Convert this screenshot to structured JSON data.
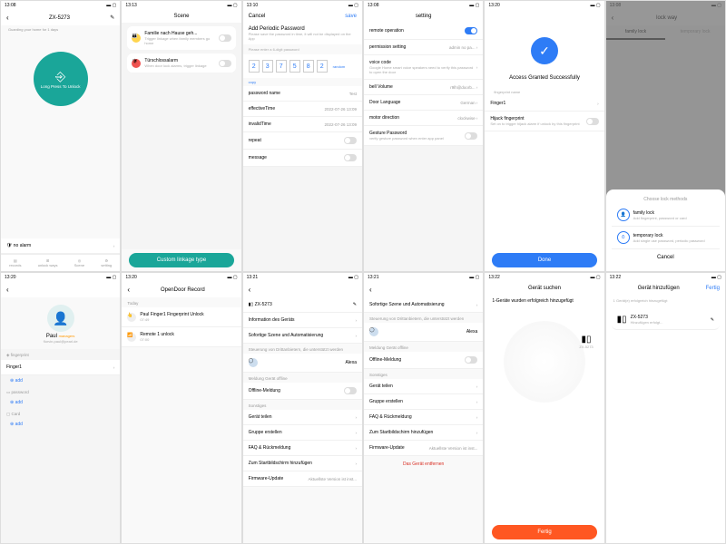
{
  "s1": {
    "time": "13:08",
    "title": "ZX-5273",
    "guard": "Guarding your home for 1 days",
    "btn": "Long Press To Unlock",
    "alarm": "no alarm",
    "tabs": [
      "records",
      "unlock ways",
      "Scene",
      "setting"
    ]
  },
  "s2": {
    "time": "13:13",
    "title": "Scene",
    "c1": "Familie nach Hause geh...",
    "c1s": "Trigger linkage when family members go home",
    "c2": "Türschlossalarm",
    "c2s": "When door lock alarms, trigger linkage",
    "btn": "Custom linkage type"
  },
  "s3": {
    "time": "13:10",
    "cancel": "Cancel",
    "save": "save",
    "title": "Add Periodic Password",
    "hint": "Please save the password in time, it will not be displayed on the App",
    "prompt": "Please enter a 6-digit password",
    "pwd": [
      "2",
      "3",
      "7",
      "5",
      "8",
      "2"
    ],
    "random": "random",
    "copy": "copy",
    "r1": "password name",
    "r1v": "Test",
    "r2": "effectiveTime",
    "r2v": "2022-07-26 13:09",
    "r3": "invalidTime",
    "r3v": "2022-07-26 13:09",
    "r4": "repeat",
    "r5": "message"
  },
  "s4": {
    "time": "13:08",
    "title": "setting",
    "r1": "remote operation",
    "r2": "permission setting",
    "r2v": "admin no pa...",
    "r3": "voice code",
    "r3s": "Google Home smart voice speakers need to verify this password to open the door",
    "r4": "bell Volume",
    "r4v": "r9lh@doorb...",
    "r5": "Door Language",
    "r5v": "German",
    "r6": "motor direction",
    "r6v": "clockwise",
    "r7": "Gesture Password",
    "r7s": "verify gesture password when enter app panel"
  },
  "s5": {
    "time": "13:20",
    "msg": "Access Granted Successfully",
    "fp": "fingerprint name",
    "fn": "Finger1",
    "hj": "Hijack fingerprint",
    "hjs": "Set on to trigger hijack alarm if unlock by this fingerprint",
    "btn": "Done"
  },
  "s6": {
    "time": "13:08",
    "title": "lock way",
    "t1": "family lock",
    "t2": "temporary lock",
    "mtitle": "Choose lock methods",
    "m1": "family lock",
    "m1s": "Add fingerprint, password or card",
    "m2": "temporary lock",
    "m2s": "Add single use password, periodic password",
    "cancel": "Cancel"
  },
  "s7": {
    "time": "13:20",
    "name": "Paul",
    "tag": "managers",
    "email": "florvin.paul@pearl.de",
    "h1": "fingerprint",
    "f1": "Finger1",
    "h2": "password",
    "h3": "Card",
    "add": "add"
  },
  "s8": {
    "time": "13:20",
    "title": "OpenDoor Record",
    "day": "Today",
    "r1": "Paul Finger1 Fingerprint Unlock",
    "r1t": "07:49",
    "r2": "Remote 1 unlock",
    "r2t": "07:00"
  },
  "s9": {
    "time": "13:21",
    "dev": "ZX-5273",
    "h1": "Information des Geräts",
    "h2": "Sofortige Szene und Automatisierung",
    "h3": "Steuerung von Drittanbietern, die unterstützt werden",
    "alexa": "Alexa",
    "h4": "Meldung Gerät offline",
    "off": "Offline-Meldung",
    "h5": "Sonstiges",
    "g1": "Gerät teilen",
    "g2": "Gruppe erstellen",
    "g3": "FAQ & Rückmeldung",
    "g4": "Zum Startbildschirm hinzufügen",
    "g5": "Firmware-Update",
    "g5v": "Aktuellste Version ist inst..."
  },
  "s10": {
    "time": "13:21",
    "title": "Sofortige Szene und Automatisierung",
    "h3": "Steuerung von Drittanbietern, die unterstützt werden",
    "alexa": "Alexa",
    "h4": "Meldung Gerät offline",
    "off": "Offline-Meldung",
    "h5": "Sonstiges",
    "g1": "Gerät teilen",
    "g2": "Gruppe erstellen",
    "g3": "FAQ & Rückmeldung",
    "g4": "Zum Startbildschirm hinzufügen",
    "g5": "Firmware-Update",
    "g5v": "Aktuellste Version ist inst...",
    "rm": "Das Gerät entfernen"
  },
  "s11": {
    "time": "13:22",
    "title": "Gerät suchen",
    "msg": "1-Geräte wurden erfolgreich hinzugefügt",
    "dev": "ZX-5273",
    "btn": "Fertig"
  },
  "s12": {
    "time": "13:22",
    "title": "Gerät hinzufügen",
    "done": "Fertig",
    "msg": "1 Gerät(e) erfolgreich hinzugefügt",
    "dev": "ZX-5273",
    "sub": "Hinzufügen erfolgt..."
  }
}
